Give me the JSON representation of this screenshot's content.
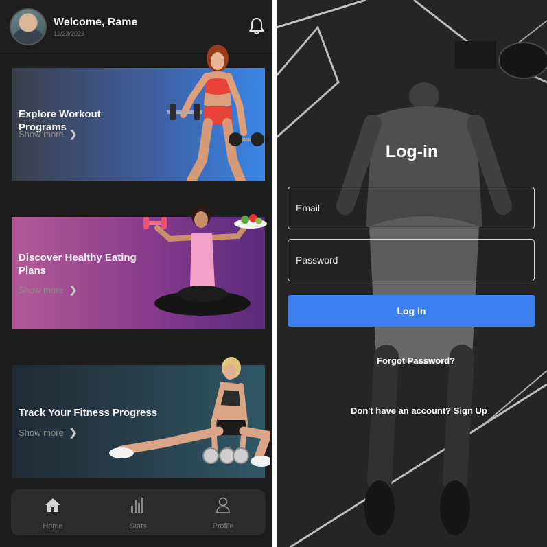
{
  "home": {
    "header": {
      "welcome": "Welcome, Rame",
      "date": "12/23/2023",
      "notification_icon": "bell-icon"
    },
    "cards": [
      {
        "title": "Explore Workout Programs",
        "show_more": "Show more",
        "accent": "#3a86e6"
      },
      {
        "title": "Discover Healthy Eating Plans",
        "show_more": "Show more",
        "accent": "#b35b96"
      },
      {
        "title": "Track Your Fitness Progress",
        "show_more": "Show more",
        "accent": "#2f5866"
      }
    ],
    "nav": [
      {
        "label": "Home",
        "icon": "home-icon",
        "active": true
      },
      {
        "label": "Stats",
        "icon": "bar-chart-icon",
        "active": false
      },
      {
        "label": "Profile",
        "icon": "user-icon",
        "active": false
      }
    ],
    "colors": {
      "background": "#1c1c1c",
      "nav_background": "#2b2b2b"
    }
  },
  "login": {
    "title": "Log-in",
    "email_placeholder": "Email",
    "password_placeholder": "Password",
    "button_label": "Log In",
    "forgot_password": "Forgot Password?",
    "signup_prompt": "Don't have an account? Sign Up",
    "colors": {
      "button": "#3d7fef",
      "field_border": "#d9d9d9"
    }
  }
}
